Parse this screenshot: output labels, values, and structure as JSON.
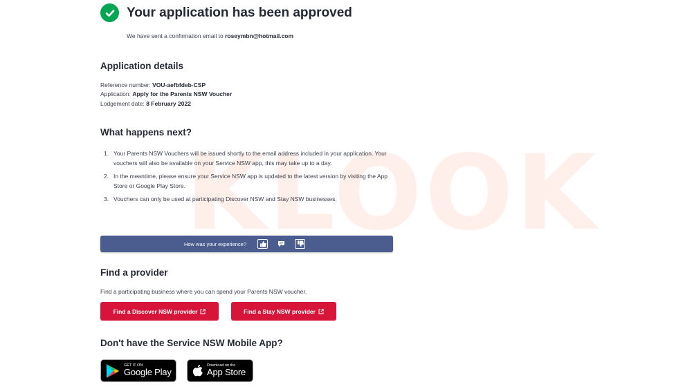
{
  "watermark": "KLOOK",
  "status": {
    "title": "Your application has been approved",
    "confirm_prefix": "We have sent a confirmation email to",
    "email": "roseymbn@hotmail.com",
    "icon": "check-circle-icon",
    "icon_color": "#00a651"
  },
  "details": {
    "heading": "Application details",
    "reference_label": "Reference number:",
    "reference_value": "VOU-aefbfdeb-CSP",
    "application_label": "Application:",
    "application_value": "Apply for the Parents NSW Voucher",
    "lodgement_label": "Lodgement date:",
    "lodgement_value": "8 February 2022"
  },
  "next": {
    "heading": "What happens next?",
    "steps": [
      {
        "num": "1.",
        "text": "Your Parents NSW Vouchers will be issued shortly to the email address included in your application. Your vouchers will also be available on your Service NSW app, this may take up to a day."
      },
      {
        "num": "2.",
        "text": "In the meantime, please ensure your Service NSW app is updated to the latest version by visiting the App Store or Google Play Store."
      },
      {
        "num": "3.",
        "text": "Vouchers can only be used at participating Discover NSW and Stay NSW businesses."
      }
    ]
  },
  "feedback": {
    "question": "How was your experience?",
    "bar_color": "#4b5d8f",
    "icons": [
      "thumbs-up-icon",
      "comment-icon",
      "thumbs-down-icon"
    ]
  },
  "provider": {
    "heading": "Find a provider",
    "text": "Find a participating business where you can spend your Parents NSW voucher.",
    "discover_button": "Find a Discover NSW provider",
    "stay_button": "Find a Stay NSW provider",
    "button_color": "#d7153a",
    "external_icon": "external-link-icon"
  },
  "app": {
    "heading": "Don't have the Service NSW Mobile App?",
    "google_small": "GET IT ON",
    "google_big": "Google Play",
    "apple_small": "Download on the",
    "apple_big": "App Store"
  }
}
